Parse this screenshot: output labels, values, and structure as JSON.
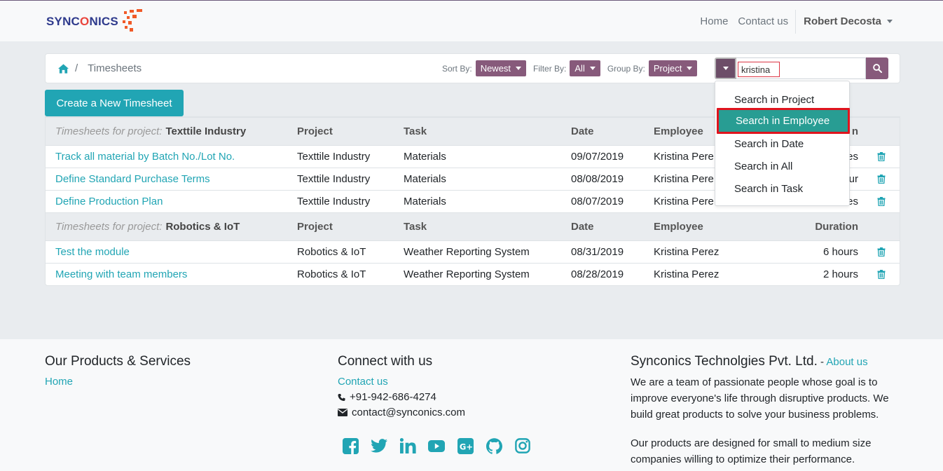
{
  "navbar": {
    "logo_text_a": "SYNC",
    "logo_text_o": "O",
    "logo_text_b": "NICS",
    "links": [
      "Home",
      "Contact us"
    ],
    "user": "Robert Decosta"
  },
  "toolbar": {
    "breadcrumb": "Timesheets",
    "sort_label": "Sort By:",
    "sort_value": "Newest",
    "filter_label": "Filter By:",
    "filter_value": "All",
    "group_label": "Group By:",
    "group_value": "Project",
    "search_value": "kristina"
  },
  "create_button": "Create a New Timesheet",
  "table": {
    "group_prefix": "Timesheets for project:",
    "headers": [
      "Project",
      "Task",
      "Date",
      "Employee",
      "Duration"
    ],
    "groups": [
      {
        "project": "Texttile Industry",
        "rows": [
          {
            "name": "Track all material by Batch No./Lot No.",
            "project": "Texttile Industry",
            "task": "Materials",
            "date": "09/07/2019",
            "employee": "Kristina Pere",
            "duration": "es"
          },
          {
            "name": "Define Standard Purchase Terms",
            "project": "Texttile Industry",
            "task": "Materials",
            "date": "08/08/2019",
            "employee": "Kristina Pere",
            "duration": "ur"
          },
          {
            "name": "Define Production Plan",
            "project": "Texttile Industry",
            "task": "Materials",
            "date": "08/07/2019",
            "employee": "Kristina Pere",
            "duration": "es"
          }
        ]
      },
      {
        "project": "Robotics & IoT",
        "rows": [
          {
            "name": "Test the module",
            "project": "Robotics & IoT",
            "task": "Weather Reporting System",
            "date": "08/31/2019",
            "employee": "Kristina Perez",
            "duration": "6 hours"
          },
          {
            "name": "Meeting with team members",
            "project": "Robotics & IoT",
            "task": "Weather Reporting System",
            "date": "08/28/2019",
            "employee": "Kristina Perez",
            "duration": "2 hours"
          }
        ]
      }
    ],
    "first_group_duration_header": "n"
  },
  "dropdown": {
    "items": [
      "Search in Project",
      "Search in Employee",
      "Search in Date",
      "Search in All",
      "Search in Task"
    ],
    "active_index": 1
  },
  "footer": {
    "col1_title": "Our Products & Services",
    "col1_link": "Home",
    "col2_title": "Connect with us",
    "col2_link": "Contact us",
    "phone": "+91-942-686-4274",
    "email": "contact@synconics.com",
    "col3_title": "Synconics Technolgies Pvt. Ltd.",
    "col3_sep": " - ",
    "col3_link": "About us",
    "para1": "We are a team of passionate people whose goal is to improve everyone's life through disruptive products. We build great products to solve your business problems.",
    "para2": "Our products are designed for small to medium size companies willing to optimize their performance.",
    "socials": [
      "facebook-icon",
      "twitter-icon",
      "linkedin-icon",
      "youtube-icon",
      "google-plus-icon",
      "github-icon",
      "instagram-icon"
    ]
  },
  "colors": {
    "brand_purple": "#875a7b",
    "teal": "#21a5b4",
    "dropdown_active": "#289d93",
    "highlight_red": "#e0141e"
  }
}
